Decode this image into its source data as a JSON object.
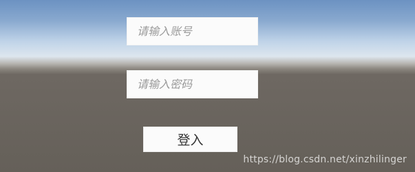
{
  "login_form": {
    "account_placeholder": "请输入账号",
    "password_placeholder": "请输入密码",
    "login_button_label": "登入"
  },
  "watermark": {
    "text": "https://blog.csdn.net/xinzhilinger"
  },
  "colors": {
    "sky_top": "#6c92c2",
    "horizon": "#dde6ee",
    "ground": "#656059",
    "field_bg": "#fbfbfb"
  }
}
